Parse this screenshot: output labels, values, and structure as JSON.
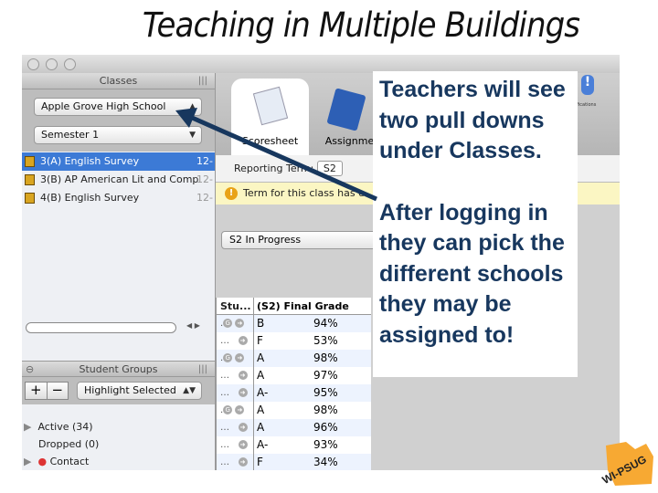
{
  "slide_title": "Teaching in Multiple Buildings",
  "callout": {
    "line1": "Teachers will see two pull downs under Classes.",
    "line2": "After logging in they can pick the different schools they may be assigned to!"
  },
  "classes": {
    "header": "Classes",
    "school_select": "Apple Grove High School",
    "term_select": "Semester 1",
    "items": [
      {
        "name": "3(A) English Survey",
        "date": "12-",
        "selected": true
      },
      {
        "name": "3(B) AP American Lit and Comp",
        "date": "12-"
      },
      {
        "name": "4(B) English Survey",
        "date": "12-"
      }
    ]
  },
  "student_groups": {
    "header": "Student Groups",
    "add": "+",
    "remove": "−",
    "highlight_select": "Highlight Selected",
    "items": [
      "Active (34)",
      "Dropped (0)",
      "Contact"
    ]
  },
  "tabs": [
    "Scoresheet",
    "Assignme"
  ],
  "toolbar": {
    "notifications": "Notifications"
  },
  "reporting_term": {
    "label": "Reporting Term:",
    "value": "S2"
  },
  "warning": "Term for this class has e",
  "status_select": "S2 In Progress",
  "grades": {
    "headers": [
      "Stu...",
      "(S2) Final Grade"
    ],
    "rows": [
      [
        "B",
        "94%",
        true
      ],
      [
        "F",
        "53%",
        false
      ],
      [
        "A",
        "98%",
        true
      ],
      [
        "A",
        "97%",
        false
      ],
      [
        "A-",
        "95%",
        false
      ],
      [
        "A",
        "98%",
        true
      ],
      [
        "A",
        "96%",
        false
      ],
      [
        "A-",
        "93%",
        false
      ],
      [
        "F",
        "34%",
        false
      ]
    ]
  },
  "logo": "WI-PSUG",
  "colors": {
    "callout": "#17375e",
    "selection": "#3c7ad6",
    "logo": "#f7a933",
    "arrow": "#17375e"
  }
}
